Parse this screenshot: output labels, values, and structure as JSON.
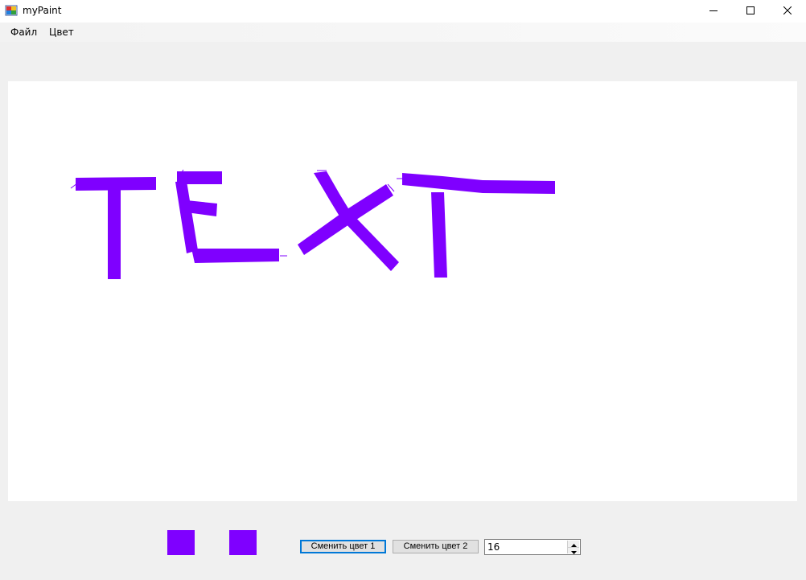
{
  "window": {
    "title": "myPaint",
    "icon": "paint-app-icon",
    "controls": [
      "minimize-icon",
      "maximize-icon",
      "close-icon"
    ]
  },
  "menu": {
    "file": "Файл",
    "color": "Цвет"
  },
  "canvas": {
    "background": "#ffffff",
    "stroke_color": "#7f00ff",
    "drawn_text": "TEXT"
  },
  "colors": {
    "color1": "#7f00ff",
    "color2": "#7f00ff"
  },
  "controls": {
    "change_color_1": "Сменить цвет 1",
    "change_color_2": "Сменить цвет 2",
    "brush_size": "16"
  }
}
